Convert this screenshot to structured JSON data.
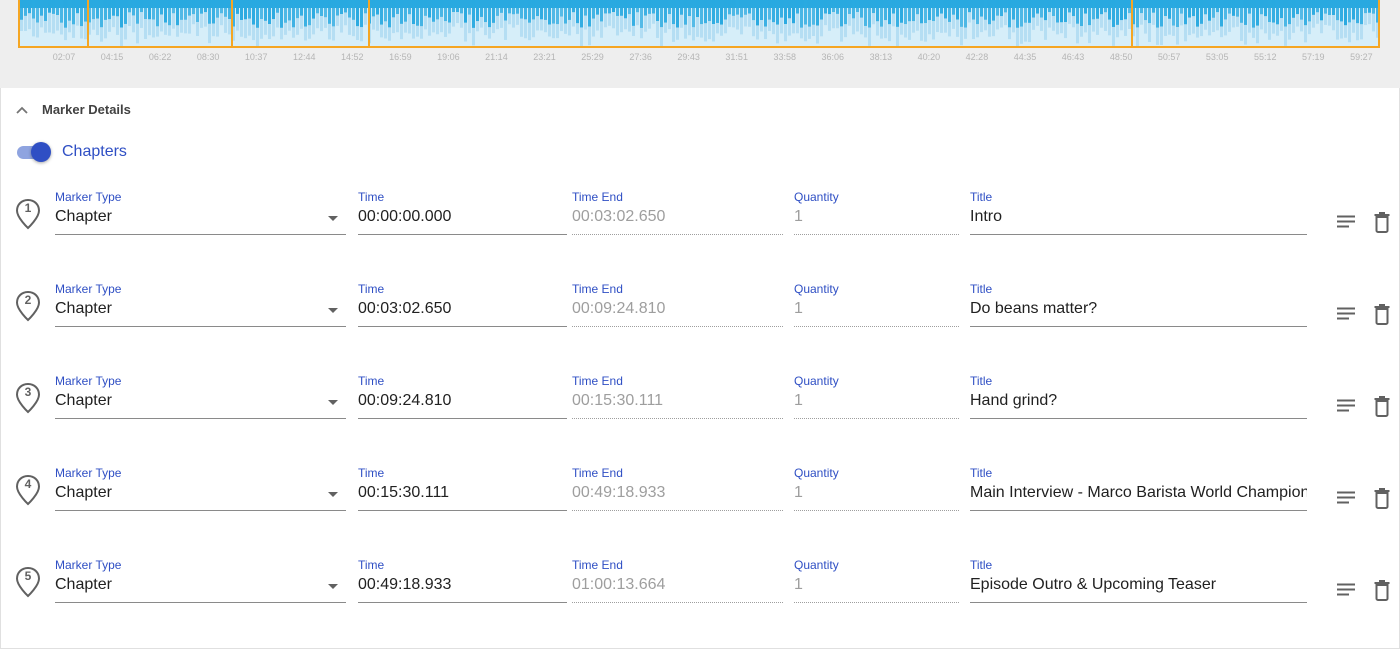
{
  "waveform": {
    "accent_color": "#f5a623",
    "wave_color": "#29a9e0",
    "ticks": [
      "02:07",
      "04:15",
      "06:22",
      "08:30",
      "10:37",
      "12:44",
      "14:52",
      "16:59",
      "19:06",
      "21:14",
      "23:21",
      "25:29",
      "27:36",
      "29:43",
      "31:51",
      "33:58",
      "36:06",
      "38:13",
      "40:20",
      "42:28",
      "44:35",
      "46:43",
      "48:50",
      "50:57",
      "53:05",
      "55:12",
      "57:19",
      "59:27"
    ]
  },
  "section": {
    "title": "Marker Details",
    "toggle_label": "Chapters",
    "toggle_on": true
  },
  "labels": {
    "marker_type": "Marker Type",
    "time": "Time",
    "time_end": "Time End",
    "quantity": "Quantity",
    "title": "Title"
  },
  "markers": [
    {
      "num": "1",
      "type": "Chapter",
      "time": "00:00:00.000",
      "time_end": "00:03:02.650",
      "quantity": "1",
      "title": "Intro"
    },
    {
      "num": "2",
      "type": "Chapter",
      "time": "00:03:02.650",
      "time_end": "00:09:24.810",
      "quantity": "1",
      "title": "Do beans matter?"
    },
    {
      "num": "3",
      "type": "Chapter",
      "time": "00:09:24.810",
      "time_end": "00:15:30.111",
      "quantity": "1",
      "title": "Hand grind?"
    },
    {
      "num": "4",
      "type": "Chapter",
      "time": "00:15:30.111",
      "time_end": "00:49:18.933",
      "quantity": "1",
      "title": "Main Interview - Marco Barista World Champion"
    },
    {
      "num": "5",
      "type": "Chapter",
      "time": "00:49:18.933",
      "time_end": "01:00:13.664",
      "quantity": "1",
      "title": "Episode Outro & Upcoming Teaser"
    }
  ]
}
